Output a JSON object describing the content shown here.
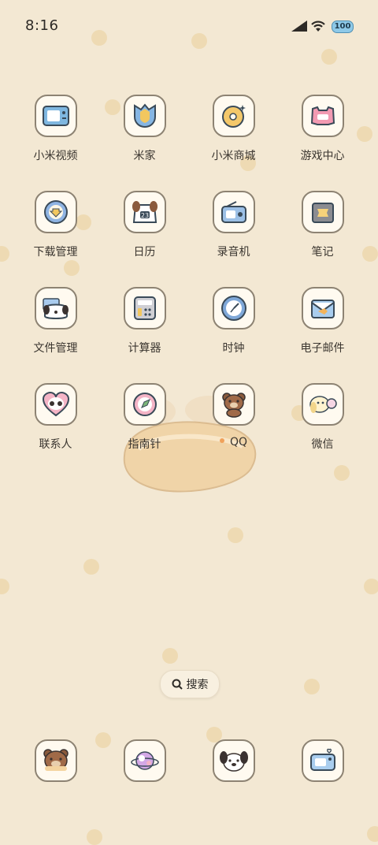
{
  "status_bar": {
    "time": "8:16",
    "battery": "100"
  },
  "apps": [
    {
      "label": "小米视频",
      "icon": "tv-cat-icon"
    },
    {
      "label": "米家",
      "icon": "tulip-icon"
    },
    {
      "label": "小米商城",
      "icon": "donut-icon"
    },
    {
      "label": "游戏中心",
      "icon": "gamepad-icon"
    },
    {
      "label": "下载管理",
      "icon": "download-icon"
    },
    {
      "label": "日历",
      "icon": "calendar-dog-icon"
    },
    {
      "label": "录音机",
      "icon": "radio-icon"
    },
    {
      "label": "笔记",
      "icon": "note-bag-icon"
    },
    {
      "label": "文件管理",
      "icon": "folder-dog-icon"
    },
    {
      "label": "计算器",
      "icon": "calculator-icon"
    },
    {
      "label": "时钟",
      "icon": "clock-icon"
    },
    {
      "label": "电子邮件",
      "icon": "mail-fish-icon"
    },
    {
      "label": "联系人",
      "icon": "heart-panda-icon"
    },
    {
      "label": "指南针",
      "icon": "compass-icon"
    },
    {
      "label": "QQ",
      "icon": "bear-icon",
      "notification_dot": "#f0a15a"
    },
    {
      "label": "微信",
      "icon": "puppy-chat-icon"
    }
  ],
  "search": {
    "label": "搜索"
  },
  "dock": [
    {
      "icon": "bear-phone-icon"
    },
    {
      "icon": "planet-cat-icon"
    },
    {
      "icon": "dog-face-icon"
    },
    {
      "icon": "camera-cat-icon"
    }
  ],
  "colors": {
    "background": "#f3e8d3",
    "dot": "#ecd6a8",
    "icon_bg": "#fffaf0",
    "icon_border": "#8d8373"
  }
}
